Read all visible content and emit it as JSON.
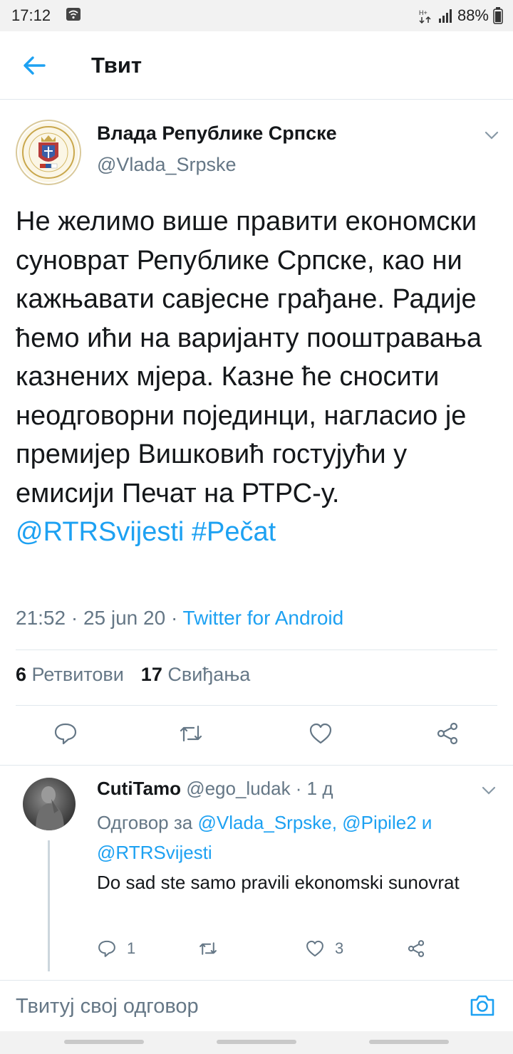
{
  "status_bar": {
    "time": "17:12",
    "battery": "88%",
    "icons": [
      "wifi-icon",
      "data-arrows-icon",
      "signal-icon",
      "battery-icon"
    ]
  },
  "header": {
    "title": "Твит",
    "back_icon": "arrow-left-icon"
  },
  "tweet": {
    "author_name": "Влада Републике Српске",
    "author_handle": "@Vlada_Srpske",
    "text": "Не желимо више правити економски суноврат Републике Српске, као ни кажњавати савјесне грађане. Радије ћемо ићи на варијанту пооштравања казнених мјера. Казне ће сносити неодговорни појединци, нагласио је премијер Вишковић гостујући у емисији Печат на РТРС-у.",
    "mention": "@RTRSvijesti",
    "hashtag": "#Pečat",
    "timestamp": "21:52 · 25 jun 20 · ",
    "source": "Twitter for Android",
    "retweets_count": "6",
    "retweets_label": "Ретвитови",
    "likes_count": "17",
    "likes_label": "Свиђања",
    "actions": [
      "reply-icon",
      "retweet-icon",
      "like-icon",
      "share-icon"
    ]
  },
  "reply": {
    "name": "CutiTamo",
    "handle": "@ego_ludak",
    "time": " · 1 д",
    "replying_to_prefix": "Одговор за ",
    "replying_to_1": "@Vlada_Srpske",
    "replying_to_sep": ", ",
    "replying_to_2": "@Pipile2",
    "replying_to_and": " и ",
    "replying_to_3": "@RTRSvijesti",
    "text": "Do sad ste samo pravili ekonomski sunovrat",
    "reply_count": "1",
    "like_count": "3"
  },
  "composer": {
    "placeholder": "Твитуј свој одговор",
    "camera_icon": "camera-icon"
  },
  "colors": {
    "accent": "#1da1f2",
    "secondary_text": "#657786",
    "primary_text": "#14171a",
    "divider": "#e1e8ed"
  }
}
